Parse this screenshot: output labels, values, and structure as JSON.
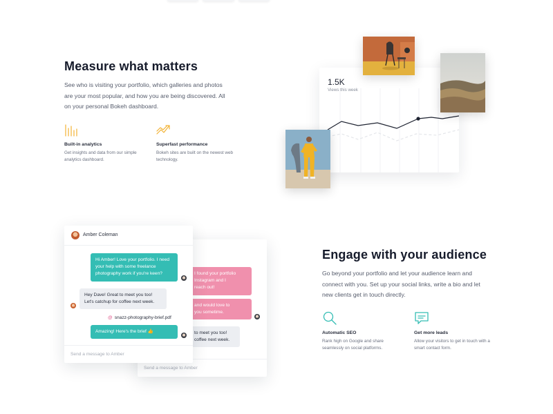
{
  "analytics_section": {
    "title": "Measure what matters",
    "description": "See who is visiting your portfolio, which galleries and photos are your most popular, and how you are being discovered. All on your personal Bokeh dashboard.",
    "features": [
      {
        "title": "Built-in analytics",
        "description": "Get insights and data from our simple analytics dashboard.",
        "icon": "bar-chart-icon"
      },
      {
        "title": "Superfast performance",
        "description": "Bokeh sites are built on the newest web technology.",
        "icon": "lightning-trend-icon"
      }
    ],
    "card": {
      "value": "1.5K",
      "label": "Views this week"
    }
  },
  "chat_front": {
    "contact_name": "Amber Coleman",
    "messages": [
      {
        "text": "Hi Amber! Love your portfolio. I need your help with some freelance photography work if you're keen?",
        "side": "right",
        "color": "#34bdb4"
      },
      {
        "text": "Hey Dave! Great to meet you too! Let's catchup for coffee next week.",
        "side": "left",
        "color": "#eceef2"
      },
      {
        "text": "Amazing! Here's the brief 👍",
        "side": "right",
        "color": "#34bdb4"
      }
    ],
    "attachment": "snazz-photography-brief.pdf",
    "placeholder": "Send a message to Amber"
  },
  "chat_back": {
    "messages": [
      {
        "text": "I found your portfolio\nInstagram and I\nreach out!",
        "color": "#f090ad"
      },
      {
        "text": "and would love to\nyou sometime.",
        "color": "#f090ad"
      },
      {
        "text": "to meet you too!\ncoffee next week.",
        "color": "#eceef2"
      }
    ],
    "placeholder": "Send a message to Amber"
  },
  "engage_section": {
    "title": "Engage with your audience",
    "description": "Go beyond your portfolio and let your audience learn and connect with you. Set up your social links, write a bio and let new clients get in touch directly.",
    "features": [
      {
        "title": "Automatic SEO",
        "description": "Rank high on Google and share seamlessly on social platforms.",
        "icon": "search-icon"
      },
      {
        "title": "Get more leads",
        "description": "Allow your visitors to get in touch with a smart contact form.",
        "icon": "message-icon"
      }
    ]
  },
  "colors": {
    "accent_yellow": "#f2b233",
    "accent_teal": "#34bdb4",
    "accent_pink": "#f090ad",
    "heading": "#161b2b"
  }
}
